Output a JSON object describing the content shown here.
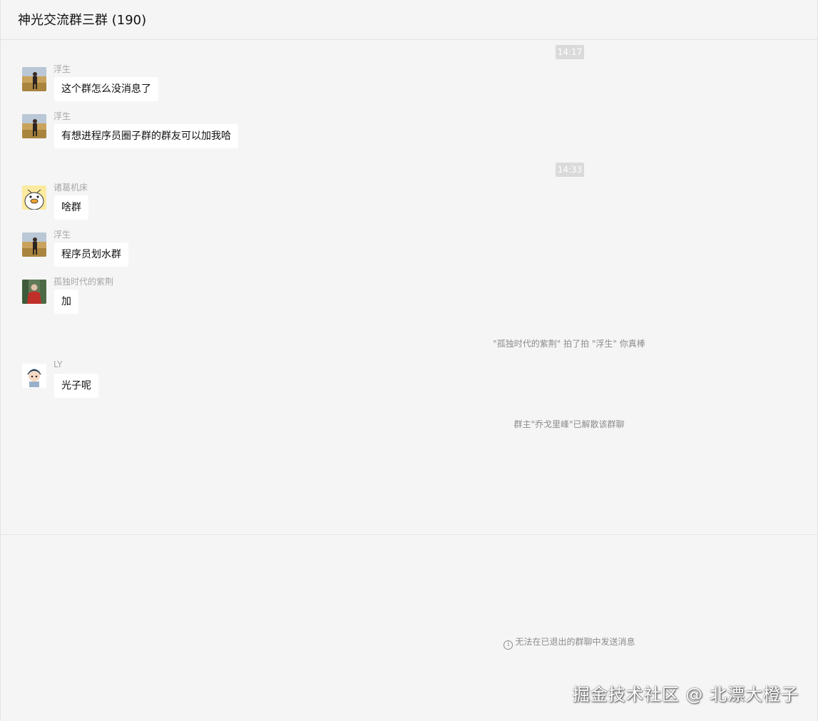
{
  "header": {
    "title": "神光交流群三群 (190)"
  },
  "timestamps": [
    "14:17",
    "14:33"
  ],
  "messages": [
    {
      "sender": "浮生",
      "text": "这个群怎么没消息了",
      "avatar": "person-on-grassland-avatar"
    },
    {
      "sender": "浮生",
      "text": "有想进程序员圈子群的群友可以加我哈",
      "avatar": "person-on-grassland-avatar"
    },
    {
      "sender": "诸葛机床",
      "text": "啥群",
      "avatar": "cartoon-duck-avatar"
    },
    {
      "sender": "浮生",
      "text": "程序员划水群",
      "avatar": "person-on-grassland-avatar"
    },
    {
      "sender": "孤独时代的紫荆",
      "text": "加",
      "avatar": "red-jacket-person-avatar"
    },
    {
      "sender": "LY",
      "text": "光子呢",
      "avatar": "cartoon-boy-avatar"
    }
  ],
  "system": {
    "pat": "\"孤独时代的紫荆\" 拍了拍 \"浮生\" 你真棒",
    "dissolved": "群主\"乔戈里峰\"已解散该群聊"
  },
  "footer": {
    "notice": "无法在已退出的群聊中发送消息",
    "info_icon": "info-circle-icon"
  },
  "watermark": "掘金技术社区 @ 北漂大橙子",
  "colors": {
    "background": "#f5f5f5",
    "bubble": "#ffffff",
    "time_chip": "#dadada",
    "muted_text": "#a7a7a7"
  }
}
